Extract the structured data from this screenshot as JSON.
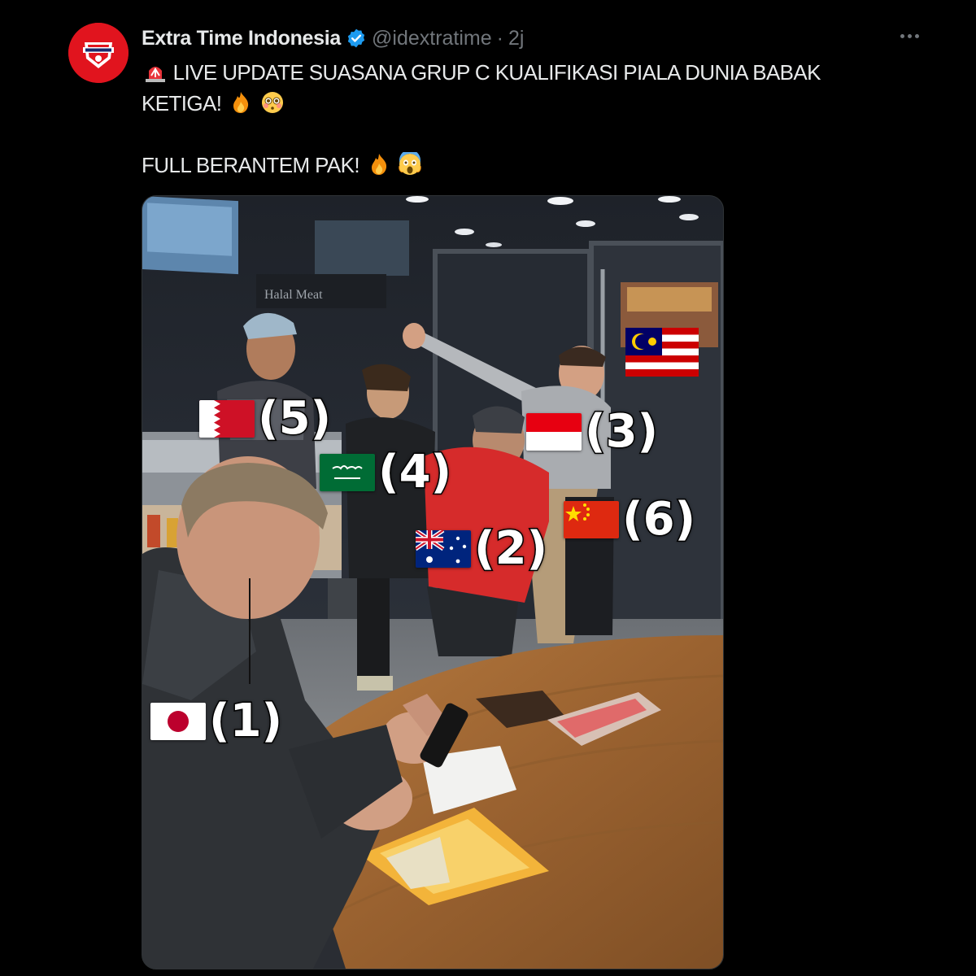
{
  "tweet": {
    "display_name": "Extra Time Indonesia",
    "handle": "@idextratime",
    "separator": "·",
    "time": "2j",
    "line1": "LIVE UPDATE SUASANA GRUP C KUALIFIKASI PIALA DUNIA BABAK",
    "line2": "KETIGA!",
    "line3": "FULL BERANTEM PAK!",
    "icons": {
      "avatar": "extra-time-logo",
      "verified": "verified-badge-icon",
      "more": "more-options-icon",
      "siren": "police-light-emoji",
      "fire": "fire-emoji",
      "flushed": "flushed-face-emoji",
      "scream": "screaming-face-emoji"
    }
  },
  "media": {
    "sign_text": "Halal Meat",
    "labels": [
      {
        "flag": "japan",
        "number": "(1)"
      },
      {
        "flag": "australia",
        "number": "(2)"
      },
      {
        "flag": "indonesia",
        "number": "(3)"
      },
      {
        "flag": "saudi-arabia",
        "number": "(4)"
      },
      {
        "flag": "bahrain",
        "number": "(5)"
      },
      {
        "flag": "china",
        "number": "(6)"
      }
    ]
  },
  "colors": {
    "background": "#000000",
    "text": "#e7e9ea",
    "muted": "#71767b",
    "verified": "#1d9bf0",
    "avatar": "#e1141e"
  }
}
